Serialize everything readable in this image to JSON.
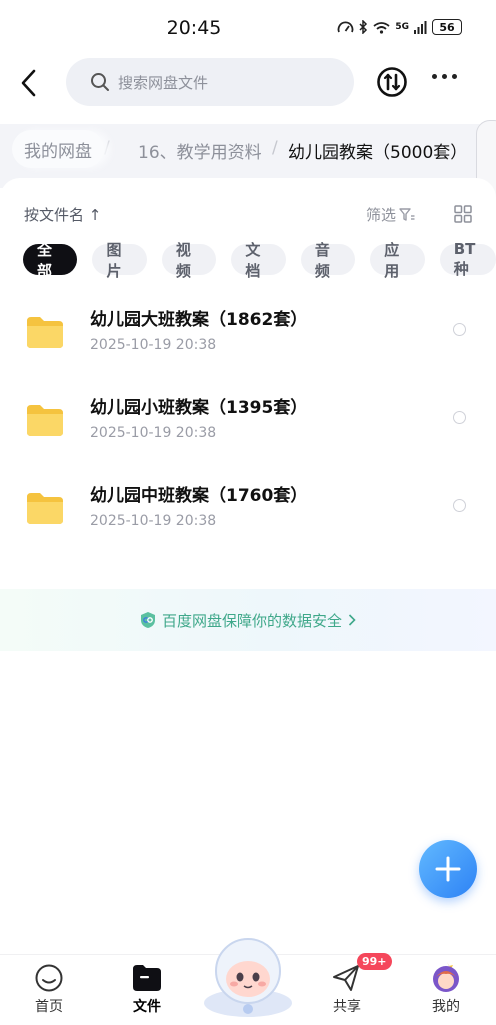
{
  "status_bar": {
    "time": "20:45",
    "network": "5G",
    "battery": "56"
  },
  "header": {
    "search_placeholder": "搜索网盘文件"
  },
  "breadcrumb": {
    "root": "我的网盘",
    "items": [
      "16、教学用资料",
      "幼儿园教案（5000套）"
    ],
    "separator": "/"
  },
  "toolbar": {
    "sort_label": "按文件名 ↑",
    "filter_label": "筛选"
  },
  "filter_chips": [
    {
      "label": "全部",
      "active": true
    },
    {
      "label": "图片"
    },
    {
      "label": "视频"
    },
    {
      "label": "文档"
    },
    {
      "label": "音频"
    },
    {
      "label": "应用"
    },
    {
      "label": "BT种"
    }
  ],
  "files": [
    {
      "name": "幼儿园大班教案（1862套）",
      "date": "2025-10-19  20:38"
    },
    {
      "name": "幼儿园小班教案（1395套）",
      "date": "2025-10-19  20:38"
    },
    {
      "name": "幼儿园中班教案（1760套）",
      "date": "2025-10-19  20:38"
    }
  ],
  "safety_banner": {
    "text": "百度网盘保障你的数据安全"
  },
  "bottom_nav": {
    "items": [
      {
        "label": "首页",
        "icon": "home-icon"
      },
      {
        "label": "文件",
        "icon": "folder-icon",
        "active": true
      },
      {
        "label": "",
        "icon": "astronaut-mascot-icon"
      },
      {
        "label": "共享",
        "icon": "send-icon"
      },
      {
        "label": "我的",
        "icon": "avatar-icon"
      }
    ],
    "share_badge": "99+"
  },
  "colors": {
    "accent": "#2d82f5",
    "folder": "#f7cd4e",
    "safety_text": "#3fa88a",
    "badge": "#f5475b"
  }
}
